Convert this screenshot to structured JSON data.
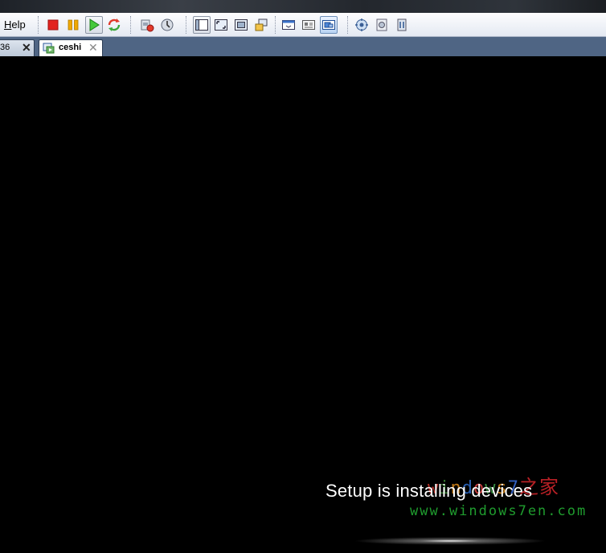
{
  "menu": {
    "help_label": "Help"
  },
  "toolbar": {
    "buttons": [
      {
        "name": "power-off-icon"
      },
      {
        "name": "suspend-icon"
      },
      {
        "name": "power-on-icon",
        "state": "pressed"
      },
      {
        "name": "reset-icon"
      },
      {
        "name": "snapshot-revert-icon"
      },
      {
        "name": "snapshot-manager-icon"
      },
      {
        "name": "quick-switch-icon"
      },
      {
        "name": "fit-window-icon"
      },
      {
        "name": "full-screen-icon"
      },
      {
        "name": "unity-icon"
      },
      {
        "name": "console-view-icon"
      },
      {
        "name": "summary-view-icon"
      },
      {
        "name": "thumbnail-view-icon",
        "state": "active"
      },
      {
        "name": "preferences-icon"
      },
      {
        "name": "settings-icon"
      },
      {
        "name": "tools-icon"
      }
    ]
  },
  "tabs": [
    {
      "label": "36",
      "close": "✕",
      "active": false
    },
    {
      "label": "ceshi",
      "close": "✕",
      "active": true
    }
  ],
  "vm_screen": {
    "status_text": "Setup is installing devices",
    "watermark_letters": [
      "w",
      "i",
      "n",
      "d",
      "o",
      "w",
      "s",
      "7"
    ],
    "watermark_cn": "之家",
    "watermark_url": "www.windows7en.com"
  },
  "colors": {
    "tabbar": "#4f6584",
    "screen": "#000000",
    "status_text": "#ffffff",
    "watermark_url": "#1f9c2e"
  }
}
